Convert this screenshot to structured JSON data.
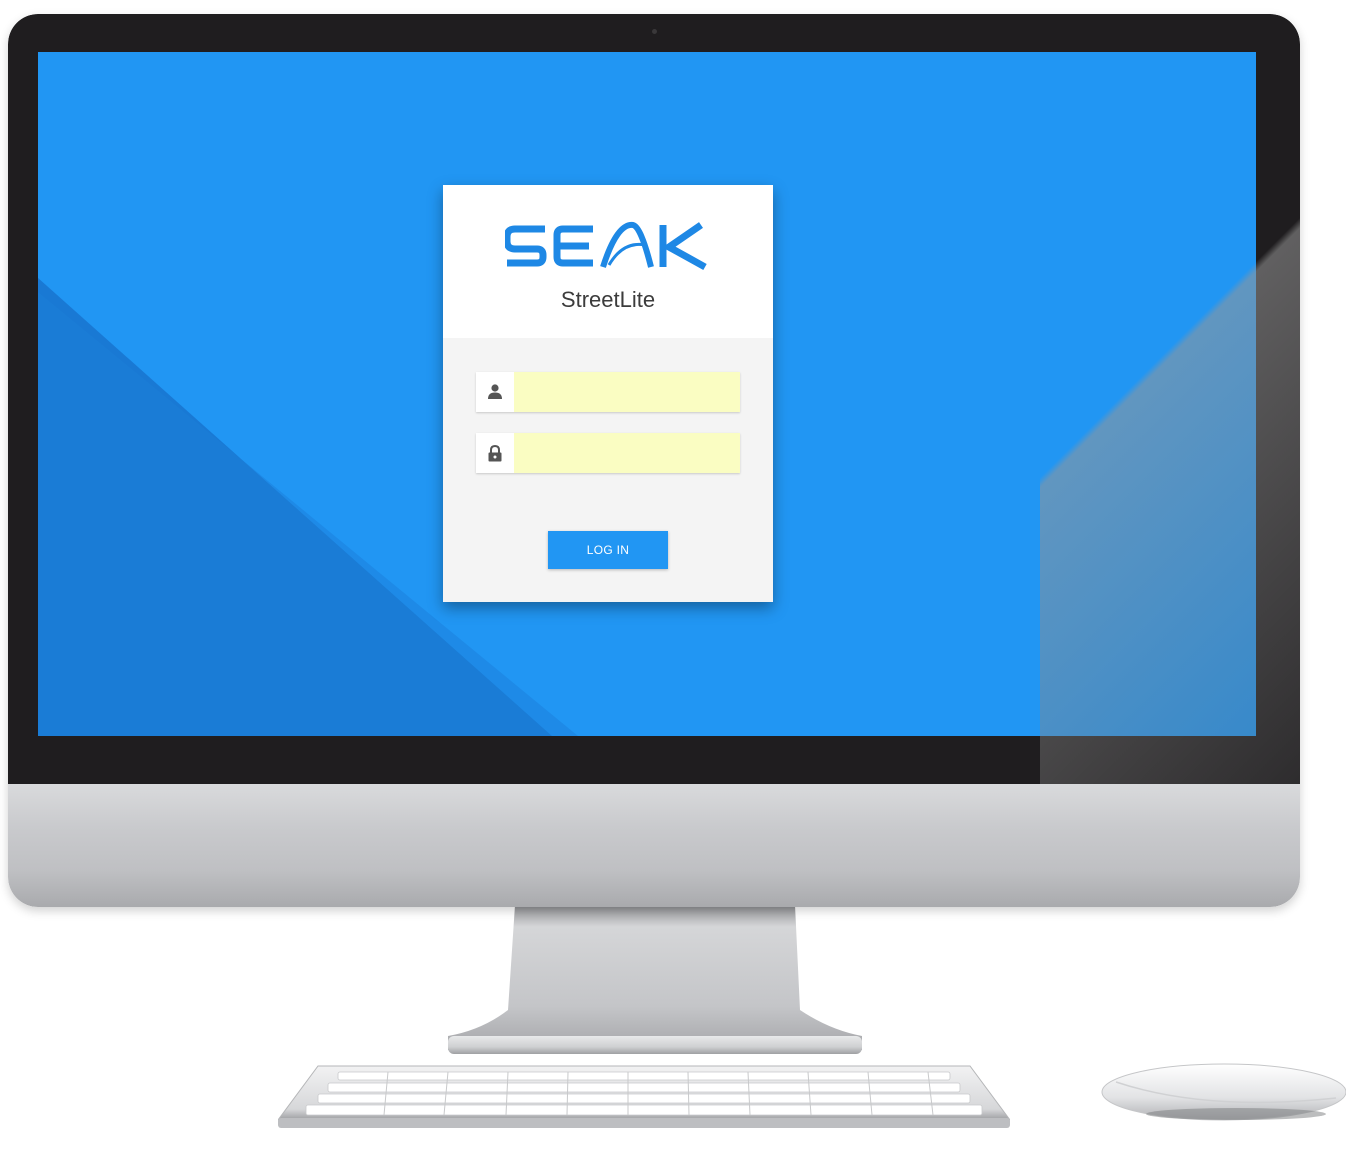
{
  "brand": {
    "logo_text": "SEAK",
    "app_name": "StreetLite",
    "color": "#1e88e5"
  },
  "login": {
    "username": {
      "icon": "user-icon",
      "value": "",
      "placeholder": ""
    },
    "password": {
      "icon": "lock-icon",
      "value": "",
      "placeholder": ""
    },
    "submit_label": "LOG IN"
  },
  "colors": {
    "background": "#2196f3",
    "background_shadow": "#1a7cd6",
    "button": "#2196f3",
    "autofill": "#fafdc2",
    "card_body": "#f4f4f4"
  }
}
